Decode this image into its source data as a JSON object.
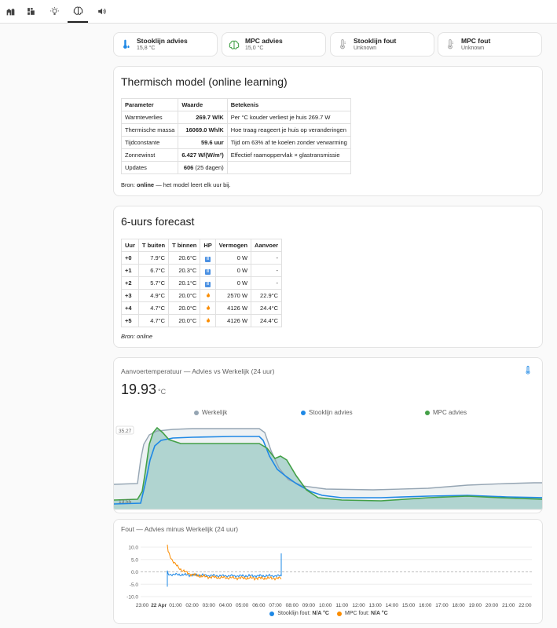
{
  "tabs": [
    {
      "icon": "home-icon"
    },
    {
      "icon": "dashboard-icon"
    },
    {
      "icon": "lightbulb-icon"
    },
    {
      "icon": "brain-icon",
      "active": true
    },
    {
      "icon": "speaker-icon"
    }
  ],
  "tiles": [
    {
      "name": "Stooklijn advies",
      "state": "15,8 °C",
      "icon": "thermometer-water-icon",
      "color": "#1e88e5"
    },
    {
      "name": "MPC advies",
      "state": "15,0 °C",
      "icon": "brain-icon",
      "color": "#43a047"
    },
    {
      "name": "Stooklijn fout",
      "state": "Unknown",
      "icon": "thermometer-icon",
      "color": "#9e9e9e"
    },
    {
      "name": "MPC fout",
      "state": "Unknown",
      "icon": "thermometer-icon",
      "color": "#9e9e9e"
    }
  ],
  "model": {
    "title": "Thermisch model (online learning)",
    "headers": [
      "Parameter",
      "Waarde",
      "Betekenis"
    ],
    "rows": [
      {
        "p": "Warmteverlies",
        "v": "269.7 W/K",
        "x": "",
        "m": "Per °C kouder verliest je huis 269.7 W"
      },
      {
        "p": "Thermische massa",
        "v": "16069.0 Wh/K",
        "x": "",
        "m": "Hoe traag reageert je huis op veranderingen"
      },
      {
        "p": "Tijdconstante",
        "v": "59.6 uur",
        "x": "",
        "m": "Tijd om 63% af te koelen zonder verwarming"
      },
      {
        "p": "Zonnewinst",
        "v": "6.427 W/(W/m²)",
        "x": "",
        "m": "Effectief raamoppervlak × glastransmissie"
      },
      {
        "p": "Updates",
        "v": "606",
        "x": " (25 dagen)",
        "m": ""
      }
    ],
    "source_prefix": "Bron: ",
    "source_value": "online",
    "source_suffix": " — het model leert elk uur bij."
  },
  "forecast": {
    "title": "6-uurs forecast",
    "headers": [
      "Uur",
      "T buiten",
      "T binnen",
      "HP",
      "Vermogen",
      "Aanvoer"
    ],
    "rows": [
      {
        "u": "+0",
        "tb": "7.9°C",
        "ti": "20.6°C",
        "hp": "off",
        "hp_label": "II",
        "p": "0 W",
        "a": "-"
      },
      {
        "u": "+1",
        "tb": "6.7°C",
        "ti": "20.3°C",
        "hp": "off",
        "hp_label": "II",
        "p": "0 W",
        "a": "-"
      },
      {
        "u": "+2",
        "tb": "5.7°C",
        "ti": "20.1°C",
        "hp": "off",
        "hp_label": "II",
        "p": "0 W",
        "a": "-"
      },
      {
        "u": "+3",
        "tb": "4.9°C",
        "ti": "20.0°C",
        "hp": "on",
        "hp_label": "",
        "p": "2570 W",
        "a": "22.9°C"
      },
      {
        "u": "+4",
        "tb": "4.7°C",
        "ti": "20.0°C",
        "hp": "on",
        "hp_label": "",
        "p": "4126 W",
        "a": "24.4°C"
      },
      {
        "u": "+5",
        "tb": "4.7°C",
        "ti": "20.0°C",
        "hp": "on",
        "hp_label": "",
        "p": "4126 W",
        "a": "24.4°C"
      }
    ],
    "source": "Bron: online"
  },
  "supply_chart": {
    "title": "Aanvoertemperatuur — Advies vs Werkelijk (24 uur)",
    "value": "19.93",
    "unit": "°C",
    "icon": "thermometer-icon",
    "chart_data": {
      "type": "line",
      "ylim_labels": [
        "35.27",
        "13.55"
      ],
      "series": [
        {
          "name": "Werkelijk",
          "color": "#95a5b3"
        },
        {
          "name": "Stooklijn advies",
          "color": "#1e88e5"
        },
        {
          "name": "MPC advies",
          "color": "#43a047"
        }
      ]
    }
  },
  "error_chart": {
    "title": "Fout — Advies minus Werkelijk (24 uur)",
    "chart_data": {
      "type": "line",
      "ylim": [
        -10,
        10
      ],
      "y_ticks": [
        "10.0",
        "5.0",
        "0.0",
        "-5.0",
        "-10.0"
      ],
      "x_ticks": [
        "23:00",
        "22 Apr",
        "01:00",
        "02:00",
        "03:00",
        "04:00",
        "05:00",
        "06:00",
        "07:00",
        "08:00",
        "09:00",
        "10:00",
        "11:00",
        "12:00",
        "13:00",
        "14:00",
        "15:00",
        "16:00",
        "17:00",
        "18:00",
        "19:00",
        "20:00",
        "21:00",
        "22:00"
      ],
      "series": [
        {
          "name": "Stooklijn fout",
          "value": "N/A °C",
          "color": "#1e88e5"
        },
        {
          "name": "MPC fout",
          "value": "N/A °C",
          "color": "#fb8c00"
        }
      ]
    }
  }
}
